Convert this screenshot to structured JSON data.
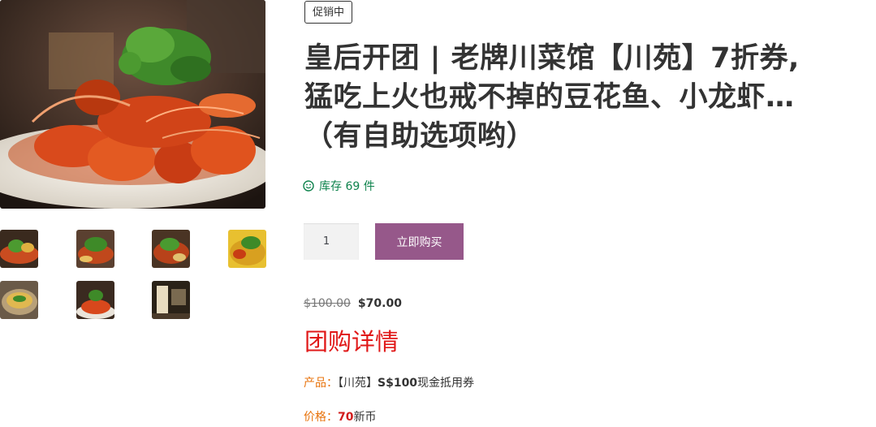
{
  "product": {
    "badge": "促销中",
    "title_lines": [
      "皇后开团 | 老牌川菜馆【川苑】7折券,",
      "猛吃上火也戒不掉的豆花鱼、小龙虾…",
      "（有自助选项哟）"
    ],
    "stock_text": "库存 69 件",
    "quantity": "1",
    "buy_label": "立即购买",
    "price_old": "$100.00",
    "price_new": "$70.00"
  },
  "details": {
    "heading": "团购详情",
    "product_label": "产品：",
    "product_name_prefix": "【川苑】",
    "product_amount": "S$100",
    "product_suffix": "现金抵用券",
    "price_label": "价格：",
    "price_value": "70",
    "price_unit": "新币"
  },
  "gallery": {
    "thumbnail_count": 7
  },
  "colors": {
    "accent": "#96588a",
    "stock": "#0f834d",
    "heading": "#e01818",
    "label": "#e8730c"
  }
}
